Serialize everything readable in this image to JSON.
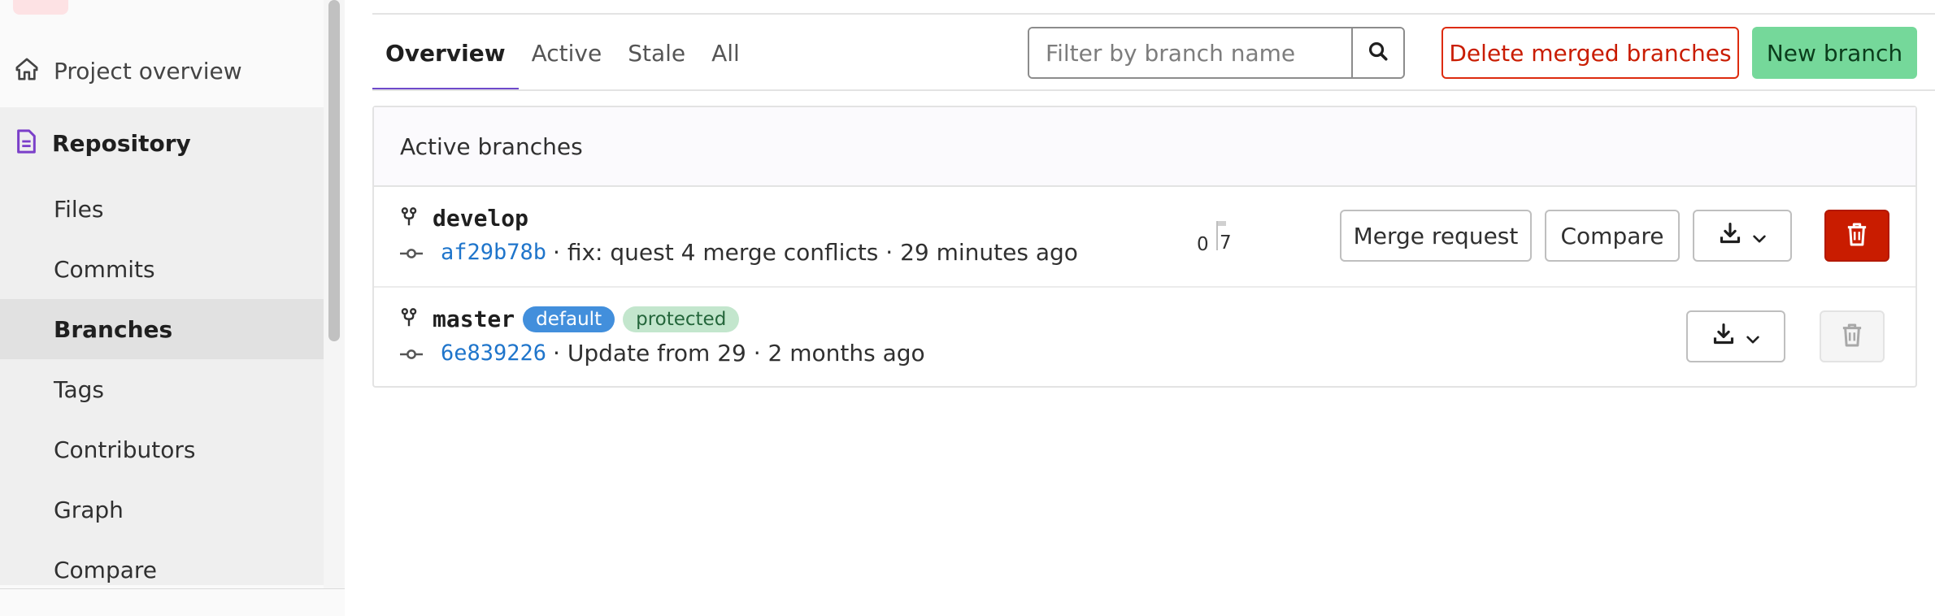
{
  "sidebar": {
    "project_overview": "Project overview",
    "repository": "Repository",
    "items": [
      {
        "label": "Files",
        "active": false
      },
      {
        "label": "Commits",
        "active": false
      },
      {
        "label": "Branches",
        "active": true
      },
      {
        "label": "Tags",
        "active": false
      },
      {
        "label": "Contributors",
        "active": false
      },
      {
        "label": "Graph",
        "active": false
      },
      {
        "label": "Compare",
        "active": false
      }
    ]
  },
  "tabs": [
    "Overview",
    "Active",
    "Stale",
    "All"
  ],
  "filter": {
    "placeholder": "Filter by branch name",
    "value": ""
  },
  "actions": {
    "delete_merged": "Delete merged branches",
    "new_branch": "New branch"
  },
  "panel": {
    "title": "Active branches"
  },
  "branches": [
    {
      "name": "develop",
      "sha": "af29b78b",
      "message": "· fix: quest 4 merge conflicts · 29 minutes ago",
      "behind": "0",
      "ahead": "7",
      "merge_request": "Merge request",
      "compare": "Compare"
    },
    {
      "name": "master",
      "badge_default": "default",
      "badge_protected": "protected",
      "sha": "6e839226",
      "message": "· Update from 29 · 2 months ago"
    }
  ],
  "colors": {
    "accent": "#6e49cb",
    "danger": "#c91c00",
    "success": "#75d89a",
    "link": "#1f75cb"
  }
}
